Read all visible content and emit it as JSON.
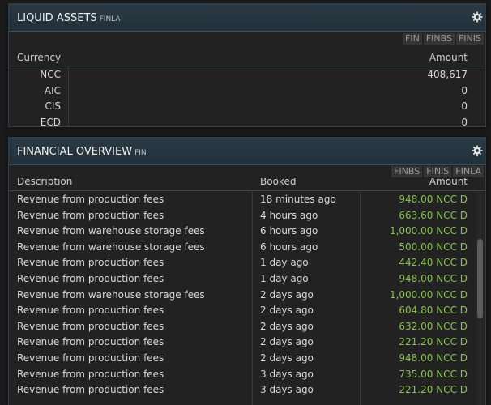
{
  "liquid_assets": {
    "title": "LIQUID ASSETS",
    "code": "FINLA",
    "tabs": [
      "FIN",
      "FINBS",
      "FINIS"
    ],
    "headers": {
      "currency": "Currency",
      "amount": "Amount"
    },
    "rows": [
      {
        "currency": "NCC",
        "amount": "408,617"
      },
      {
        "currency": "AIC",
        "amount": "0"
      },
      {
        "currency": "CIS",
        "amount": "0"
      },
      {
        "currency": "ECD",
        "amount": "0"
      }
    ]
  },
  "financial_overview": {
    "title": "FINANCIAL OVERVIEW",
    "code": "FIN",
    "tabs": [
      "FINBS",
      "FINIS",
      "FINLA"
    ],
    "headers": {
      "description": "Description",
      "booked": "Booked",
      "amount": "Amount"
    },
    "rows": [
      {
        "description": "Revenue from production fees",
        "booked": "18 minutes ago",
        "amount": "948.00 NCC D"
      },
      {
        "description": "Revenue from production fees",
        "booked": "4 hours ago",
        "amount": "663.60 NCC D"
      },
      {
        "description": "Revenue from warehouse storage fees",
        "booked": "6 hours ago",
        "amount": "1,000.00 NCC D"
      },
      {
        "description": "Revenue from warehouse storage fees",
        "booked": "6 hours ago",
        "amount": "500.00 NCC D"
      },
      {
        "description": "Revenue from production fees",
        "booked": "1 day ago",
        "amount": "442.40 NCC D"
      },
      {
        "description": "Revenue from production fees",
        "booked": "1 day ago",
        "amount": "948.00 NCC D"
      },
      {
        "description": "Revenue from warehouse storage fees",
        "booked": "2 days ago",
        "amount": "1,000.00 NCC D"
      },
      {
        "description": "Revenue from production fees",
        "booked": "2 days ago",
        "amount": "604.80 NCC D"
      },
      {
        "description": "Revenue from production fees",
        "booked": "2 days ago",
        "amount": "632.00 NCC D"
      },
      {
        "description": "Revenue from production fees",
        "booked": "2 days ago",
        "amount": "221.20 NCC D"
      },
      {
        "description": "Revenue from production fees",
        "booked": "2 days ago",
        "amount": "948.00 NCC D"
      },
      {
        "description": "Revenue from production fees",
        "booked": "3 days ago",
        "amount": "735.00 NCC D"
      },
      {
        "description": "Revenue from production fees",
        "booked": "3 days ago",
        "amount": "221.20 NCC D"
      }
    ]
  },
  "icons": {
    "settings": "gear-icon"
  },
  "colors": {
    "credit_amount": "#88c24e",
    "header_bg": "#223039",
    "panel_bg": "#222222"
  }
}
